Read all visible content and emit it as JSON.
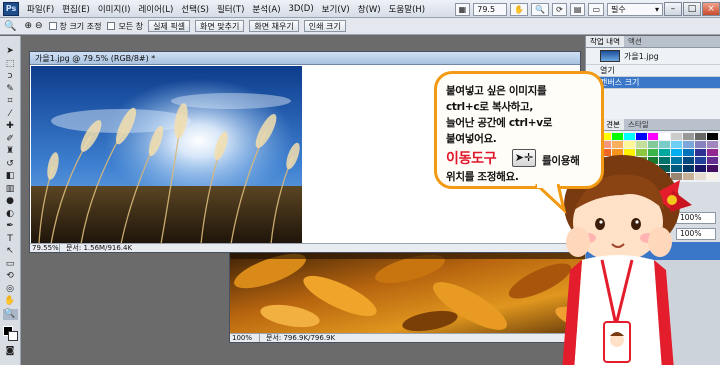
{
  "app": {
    "logo": "Ps"
  },
  "menu": {
    "items": [
      "파일(F)",
      "편집(E)",
      "이미지(I)",
      "레이어(L)",
      "선택(S)",
      "필터(T)",
      "분석(A)",
      "3D(D)",
      "보기(V)",
      "창(W)",
      "도움말(H)"
    ],
    "zoom": "79.5",
    "workspace": "필수"
  },
  "options": {
    "resize_windows_label": "창 크기 조정",
    "all_windows_label": "모든 창",
    "actual_pixels": "실제 픽셀",
    "fit_screen": "화면 맞추기",
    "fill_screen": "화면 채우기",
    "print_size": "인쇄 크기"
  },
  "doc1": {
    "title": "가을1.jpg @ 79.5% (RGB/8#) *",
    "zoom": "79.55%",
    "info": "문서: 1.56M/916.4K"
  },
  "doc2": {
    "zoom": "100%",
    "info": "문서: 796.9K/796.9K"
  },
  "panels": {
    "history_tabs": [
      "작업 내역",
      "액션"
    ],
    "history_snapshot": "가을1.jpg",
    "history_items": [
      "열기",
      "캔버스 크기"
    ],
    "swatch_tabs": [
      "색상 견본",
      "스타일"
    ],
    "opacity_1": "100%",
    "opacity_2": "100%"
  },
  "bubble": {
    "line1": "붙여넣고 싶은 이미지를",
    "line2": "ctrl+c로 복사하고,",
    "line3": "늘어난 공간에 ctrl+v로",
    "line4": "붙여넣어요.",
    "highlight": "이동도구",
    "line5_tail": "를이용해",
    "line6": "위치를 조정해요."
  },
  "colors": {
    "accent_orange": "#f29a14",
    "highlight_red": "#e0162b",
    "selected_blue": "#3b77c9"
  }
}
